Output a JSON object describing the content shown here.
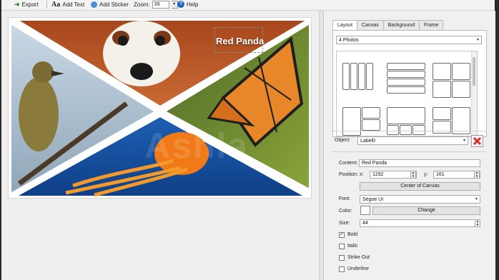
{
  "toolbar": {
    "export_label": "Export",
    "add_text_label": "Add Text",
    "add_sticker_label": "Add Sticker",
    "zoom_label": "Zoom:",
    "zoom_value": "39",
    "help_label": "Help"
  },
  "canvas": {
    "overlay_text": "Red Panda",
    "watermark_text": "Ashla"
  },
  "panel": {
    "tabs": [
      "Layout",
      "Canvas",
      "Background",
      "Frame"
    ],
    "layout_select": "4 Photos",
    "object_label": "Object:",
    "object_value": "Label0",
    "content_label": "Content:",
    "content_value": "Red Panda",
    "position_label": "Position:",
    "x_label": "x:",
    "x_value": "1292",
    "y_label": "y:",
    "y_value": "161",
    "center_button": "Center of Canvas",
    "font_label": "Font:",
    "font_value": "Segoe UI",
    "color_label": "Color:",
    "color_value": "#ffffff",
    "change_button": "Change",
    "size_label": "Size:",
    "size_value": "44",
    "checkboxes": [
      {
        "label": "Bold",
        "checked": true
      },
      {
        "label": "Italic",
        "checked": false
      },
      {
        "label": "Strike Out",
        "checked": false
      },
      {
        "label": "Underline",
        "checked": false
      }
    ]
  },
  "colors": {
    "accent": "#1565c0",
    "delete_red": "#d32f2f"
  }
}
